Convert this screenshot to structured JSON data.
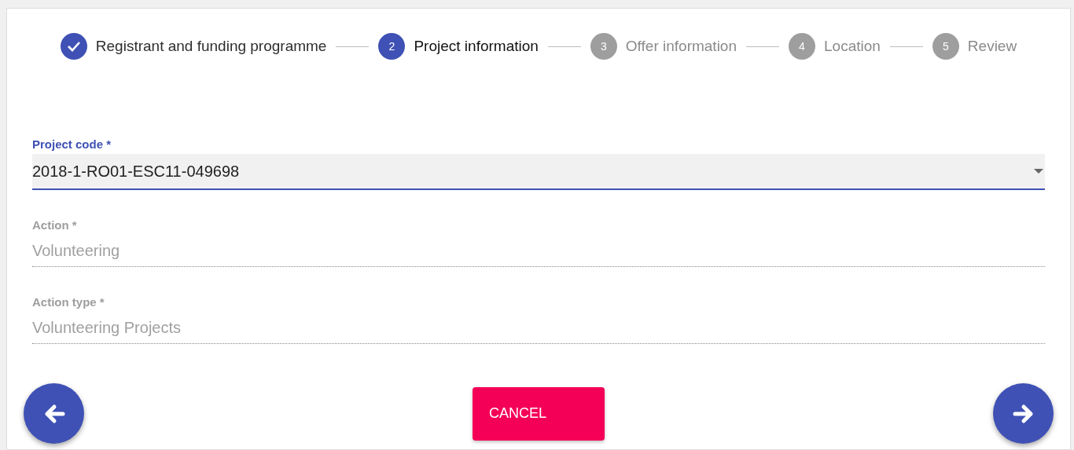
{
  "steps": [
    {
      "label": "Registrant and funding programme",
      "completed": true,
      "selected": false
    },
    {
      "number": "2",
      "label": "Project information",
      "completed": false,
      "selected": true
    },
    {
      "number": "3",
      "label": "Offer information",
      "completed": false,
      "selected": false
    },
    {
      "number": "4",
      "label": "Location",
      "completed": false,
      "selected": false
    },
    {
      "number": "5",
      "label": "Review",
      "completed": false,
      "selected": false
    }
  ],
  "fields": [
    {
      "kind": "select",
      "label": "Project code",
      "required_mark": "*",
      "value": "2018-1-RO01-ESC11-049698",
      "disabled": false
    },
    {
      "kind": "text",
      "label": "Action",
      "required_mark": "*",
      "value": "Volunteering",
      "disabled": true
    },
    {
      "kind": "text",
      "label": "Action type",
      "required_mark": "*",
      "value": "Volunteering Projects",
      "disabled": true
    }
  ],
  "cancel_button": "CANCEL"
}
